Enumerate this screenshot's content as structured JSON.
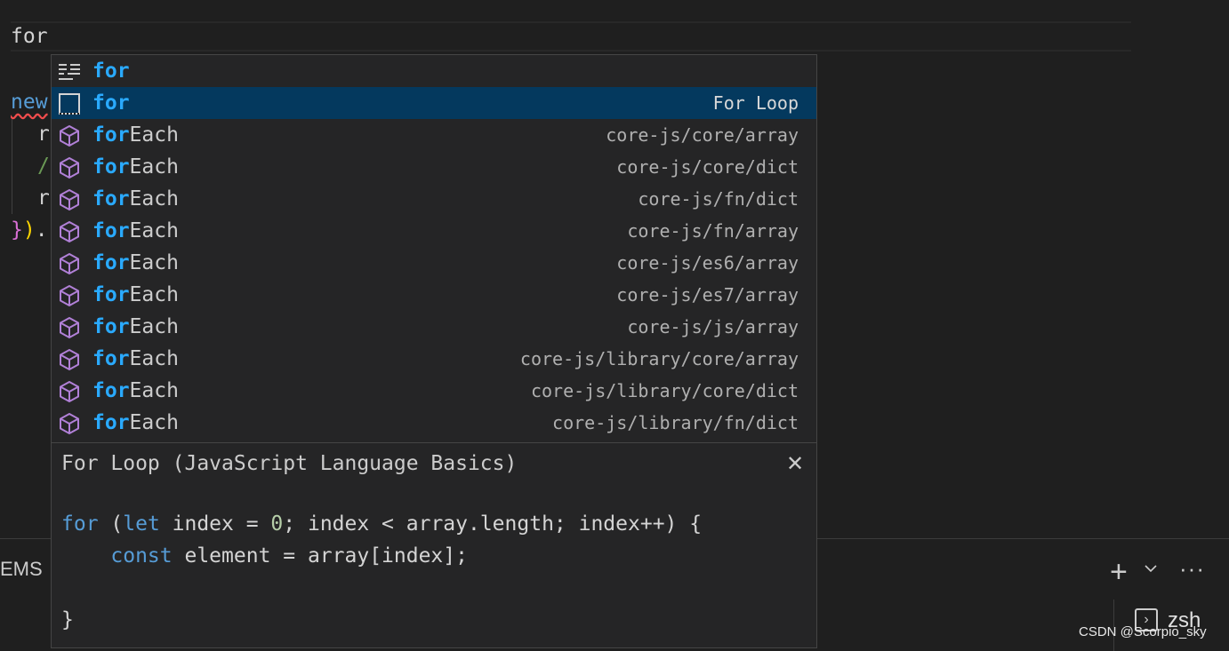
{
  "editor": {
    "line1": "for",
    "line2": "new",
    "line3": "r",
    "line4": "/",
    "line5": "r",
    "line6_brace": "}",
    "line6_paren": ")",
    "line6_dot": "."
  },
  "suggest": {
    "items": [
      {
        "match": "for",
        "rest": "",
        "detail": "",
        "icon": "keyword-icon"
      },
      {
        "match": "for",
        "rest": "",
        "detail": "For Loop",
        "icon": "snippet-icon"
      },
      {
        "match": "for",
        "rest": "Each",
        "detail": "core-js/core/array",
        "icon": "module-icon"
      },
      {
        "match": "for",
        "rest": "Each",
        "detail": "core-js/core/dict",
        "icon": "module-icon"
      },
      {
        "match": "for",
        "rest": "Each",
        "detail": "core-js/fn/dict",
        "icon": "module-icon"
      },
      {
        "match": "for",
        "rest": "Each",
        "detail": "core-js/fn/array",
        "icon": "module-icon"
      },
      {
        "match": "for",
        "rest": "Each",
        "detail": "core-js/es6/array",
        "icon": "module-icon"
      },
      {
        "match": "for",
        "rest": "Each",
        "detail": "core-js/es7/array",
        "icon": "module-icon"
      },
      {
        "match": "for",
        "rest": "Each",
        "detail": "core-js/js/array",
        "icon": "module-icon"
      },
      {
        "match": "for",
        "rest": "Each",
        "detail": "core-js/library/core/array",
        "icon": "module-icon"
      },
      {
        "match": "for",
        "rest": "Each",
        "detail": "core-js/library/core/dict",
        "icon": "module-icon"
      },
      {
        "match": "for",
        "rest": "Each",
        "detail": "core-js/library/fn/dict",
        "icon": "module-icon"
      }
    ],
    "selected_index": 1
  },
  "details": {
    "title": "For Loop (JavaScript Language Basics)",
    "close_glyph": "✕",
    "code": {
      "l1": {
        "kw_for": "for",
        "p1": " (",
        "kw_let": "let",
        "p2": " index = ",
        "num": "0",
        "p3": "; index < array.length; index++) {"
      },
      "l2": {
        "indent": "    ",
        "kw_const": "const",
        "p": " element = array[index];"
      },
      "l4": "}"
    }
  },
  "panel": {
    "tab_label": "EMS",
    "add_glyph": "+",
    "chevron_glyph": "⌄",
    "more_glyph": "···",
    "terminal_icon_glyph": "›",
    "terminal_label": "zsh"
  },
  "watermark": "CSDN @Scorpio_sky",
  "colors": {
    "background": "#1f1f1f",
    "widget_bg": "#252526",
    "selected_row": "#04395e",
    "match_highlight": "#2aaaff",
    "module_icon": "#b180d7",
    "keyword": "#569cd6"
  }
}
